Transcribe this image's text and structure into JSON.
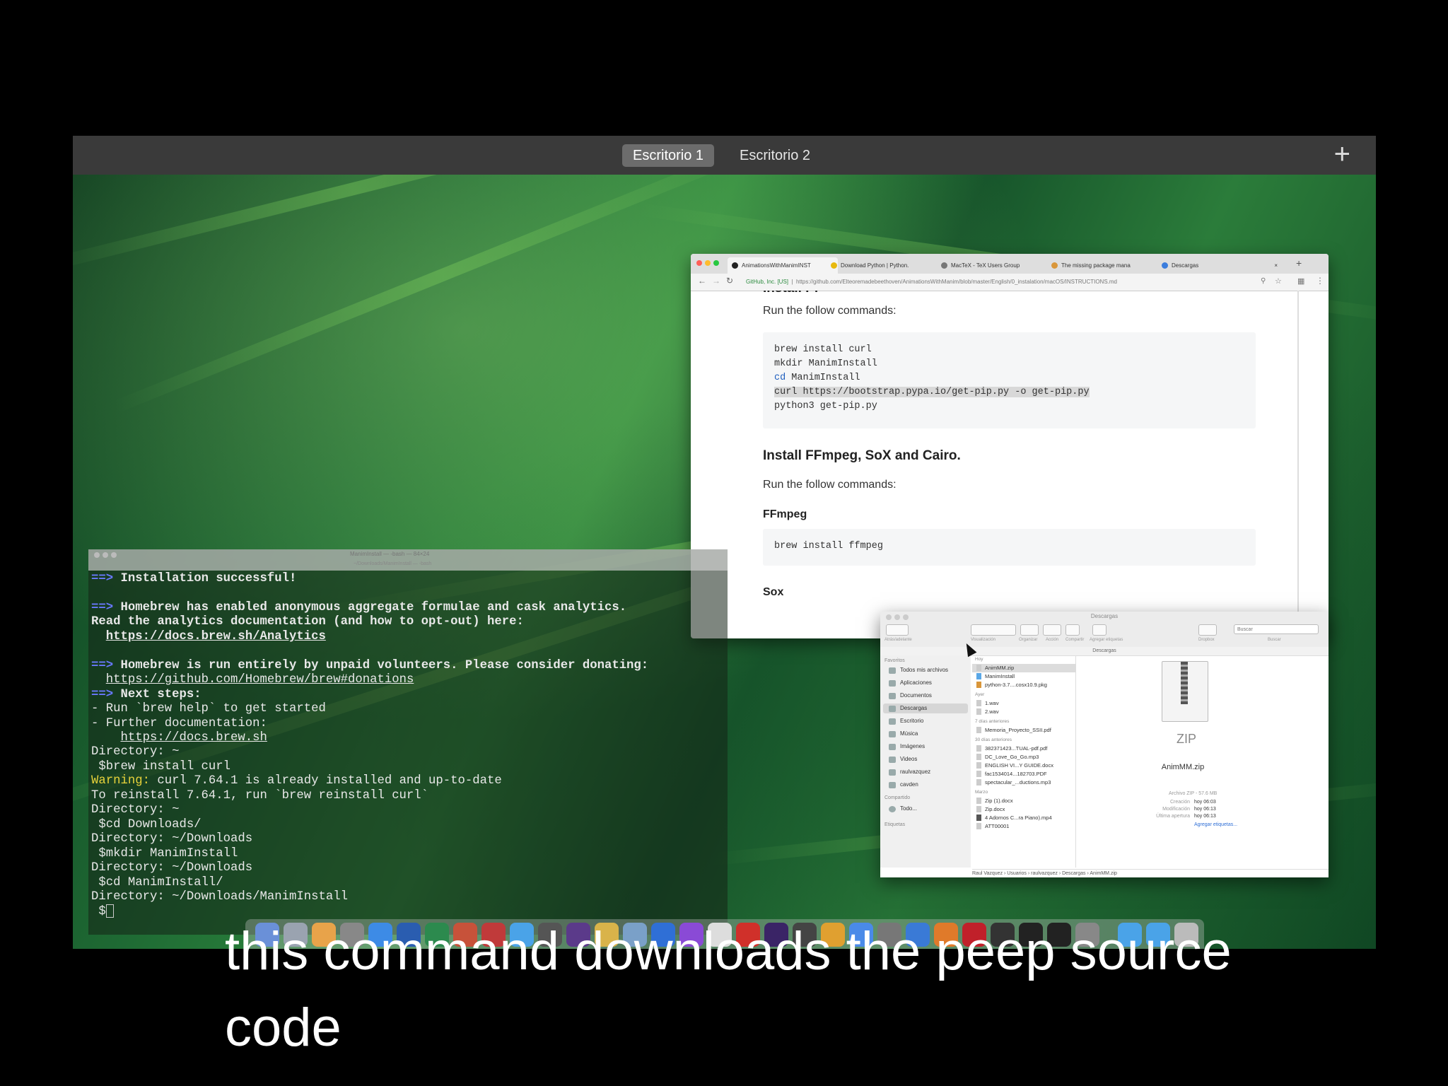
{
  "spaces": {
    "tabs": [
      "Escritorio 1",
      "Escritorio 2"
    ],
    "add_label": "+"
  },
  "browser": {
    "tabs": [
      {
        "label": "AnimationsWithManimINST",
        "close": "×"
      },
      {
        "label": "Download Python | Python.",
        "close": "×"
      },
      {
        "label": "MacTeX - TeX Users Group",
        "close": "×"
      },
      {
        "label": "The missing package mana",
        "close": "×"
      },
      {
        "label": "Descargas",
        "close": "×"
      }
    ],
    "secure_label": "GitHub, Inc. [US]",
    "url": "https://github.com/Elteoremadebeethoven/AnimationsWithManim/blob/master/English/0_instalation/macOS/INSTRUCTIONS.md",
    "content": {
      "heading_partial": "Install Pi",
      "run_cmds_1": "Run the follow commands:",
      "code_1": [
        "brew install curl",
        "mkdir ManimInstall",
        "cd ManimInstall",
        "curl https://bootstrap.pypa.io/get-pip.py -o get-pip.py",
        "python3 get-pip.py"
      ],
      "code_1_cd_keyword": "cd",
      "code_1_cd_rest": " ManimInstall",
      "h3_ffmpeg": "Install FFmpeg, SoX and Cairo.",
      "run_cmds_2": "Run the follow commands:",
      "h4_ffmpeg": "FFmpeg",
      "code_2": "brew install ffmpeg",
      "h4_sox": "Sox"
    }
  },
  "terminal": {
    "title": "ManimInstall — -bash — 84×24",
    "subtitle": "~/Downloads/ManimInstall — -bash",
    "arrow": "==>",
    "lines": {
      "l1": "Installation successful!",
      "l3": "Homebrew has enabled anonymous aggregate formulae and cask analytics.",
      "l4": "Read the analytics documentation (and how to opt-out) here:",
      "l5": "https://docs.brew.sh/Analytics",
      "l7": "Homebrew is run entirely by unpaid volunteers. Please consider donating:",
      "l8": "https://github.com/Homebrew/brew#donations",
      "l9": "Next steps:",
      "l10": "- Run `brew help` to get started",
      "l11": "- Further documentation:",
      "l12": "https://docs.brew.sh",
      "l13": "Directory: ~",
      "l14": " $brew install curl",
      "l15_warn": "Warning:",
      "l15_rest": " curl 7.64.1 is already installed and up-to-date",
      "l16": "To reinstall 7.64.1, run `brew reinstall curl`",
      "l17": "Directory: ~",
      "l18": " $cd Downloads/",
      "l19": "Directory: ~/Downloads",
      "l20": " $mkdir ManimInstall",
      "l21": "Directory: ~/Downloads",
      "l22": " $cd ManimInstall/",
      "l23": "Directory: ~/Downloads/ManimInstall",
      "l24": " $"
    }
  },
  "finder": {
    "title": "Descargas",
    "toolbar": [
      "Atrás/adelante",
      "Visualización",
      "Organizar",
      "Acción",
      "Compartir",
      "Agregar etiquetas",
      "Dropbox",
      "Buscar"
    ],
    "search_placeholder": "Buscar",
    "path_top": "Descargas",
    "sidebar": {
      "favorites_header": "Favoritos",
      "items": [
        "Todos mis archivos",
        "Aplicaciones",
        "Documentos",
        "Descargas",
        "Escritorio",
        "Música",
        "Imágenes",
        "Videos",
        "raulvazquez",
        "cavden"
      ],
      "shared_header": "Compartido",
      "shared_items": [
        "Todo..."
      ],
      "tags_header": "Etiquetas"
    },
    "list": {
      "today": "Hoy",
      "today_items": [
        "AnimMM.zip",
        "ManimInstall",
        "python-3.7....cosx10.9.pkg"
      ],
      "yesterday": "Ayer",
      "yesterday_items": [
        "1.wav",
        "2.wav"
      ],
      "week": "7 días anteriores",
      "week_items": [
        "Memoria_Proyecto_SSII.pdf"
      ],
      "month": "30 días anteriores",
      "month_items": [
        "382371423...TUAL-pdf.pdf",
        "DC_Love_Go_Go.mp3",
        "ENGLISH VI...Y GUIDE.docx",
        "fac1534014...182703.PDF",
        "spectacular_...ductions.mp3"
      ],
      "march": "Marzo",
      "march_items": [
        "Zip (1).docx",
        "Zip.docx",
        "4 Adornos C...ra Piano).mp4",
        "ATT00001"
      ]
    },
    "preview": {
      "zip_label": "ZIP",
      "name": "AnimMM.zip",
      "kind": "Archivo ZIP - 57.6 MB",
      "created_label": "Creación",
      "created": "hoy 06:03",
      "modified_label": "Modificación",
      "modified": "hoy 06:13",
      "opened_label": "Última apertura",
      "opened": "hoy 06:13",
      "add_tags": "Agregar etiquetas..."
    },
    "pathbar": "Raul Vazquez  ›  Usuarios  ›  raulvazquez  ›  Descargas  ›  AnimMM.zip"
  },
  "caption": {
    "line1": "this command downloads the peep source",
    "line2": "code"
  },
  "colors": {
    "arrow": "#6a79ff",
    "warning": "#e7d23a",
    "link": "#1f5fbf"
  }
}
